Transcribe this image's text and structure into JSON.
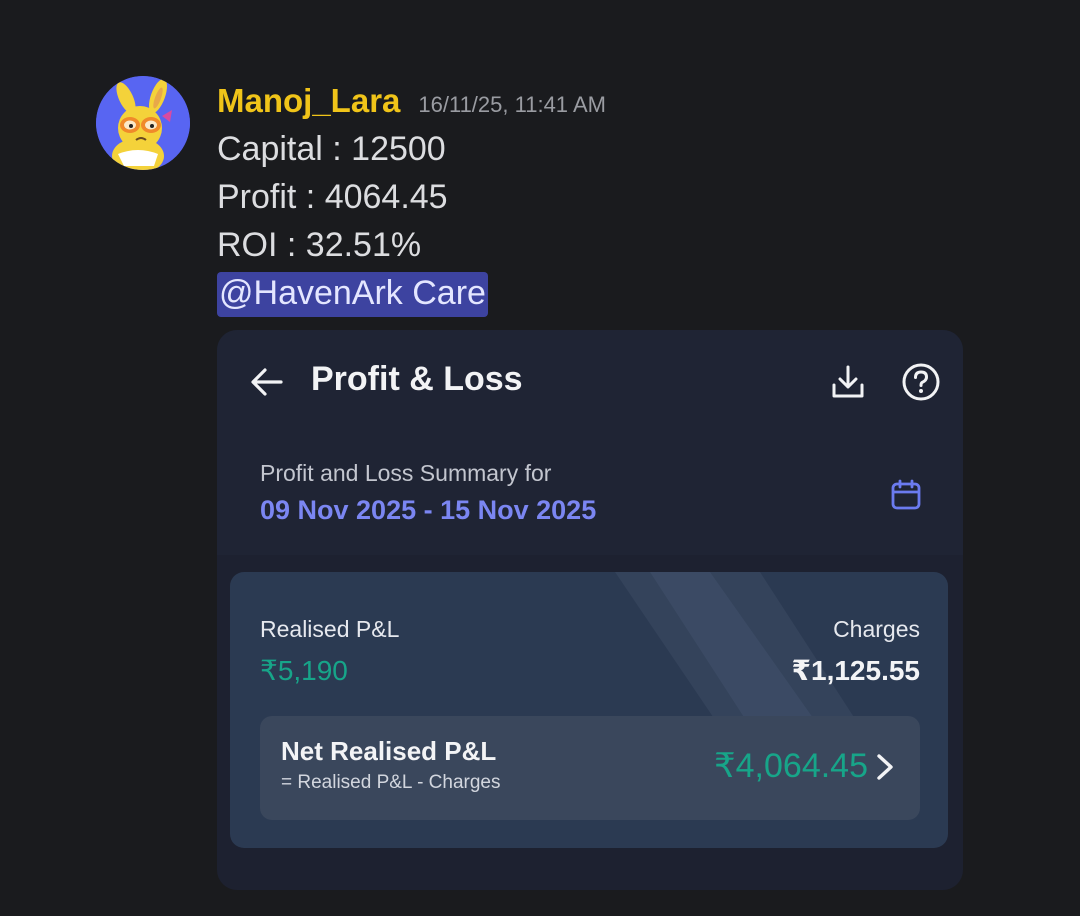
{
  "message": {
    "username": "Manoj_Lara",
    "timestamp": "16/11/25, 11:41 AM",
    "lines": [
      "Capital : 12500",
      "Profit : 4064.45",
      "ROI : 32.51%"
    ],
    "mention": "@HavenArk Care"
  },
  "embed": {
    "title": "Profit & Loss",
    "icons": {
      "back": "arrow-left-icon",
      "download": "download-icon",
      "help": "question-circle-icon",
      "calendar": "calendar-icon",
      "chevron": "chevron-right-icon"
    },
    "summary": {
      "label": "Profit and Loss Summary for",
      "range": "09 Nov 2025 - 15 Nov 2025"
    },
    "card": {
      "realised_label": "Realised P&L",
      "realised_value": "₹5,190",
      "charges_label": "Charges",
      "charges_value": "₹1,125.55",
      "net_title": "Net Realised P&L",
      "net_formula": "= Realised P&L - Charges",
      "net_value": "₹4,064.45"
    }
  },
  "colors": {
    "background": "#1a1b1e",
    "username": "#f0c419",
    "mention_bg": "#3d43a0",
    "date_range": "#7b86f2",
    "profit_green": "#17a589",
    "card_bg": "#2b3a52"
  }
}
